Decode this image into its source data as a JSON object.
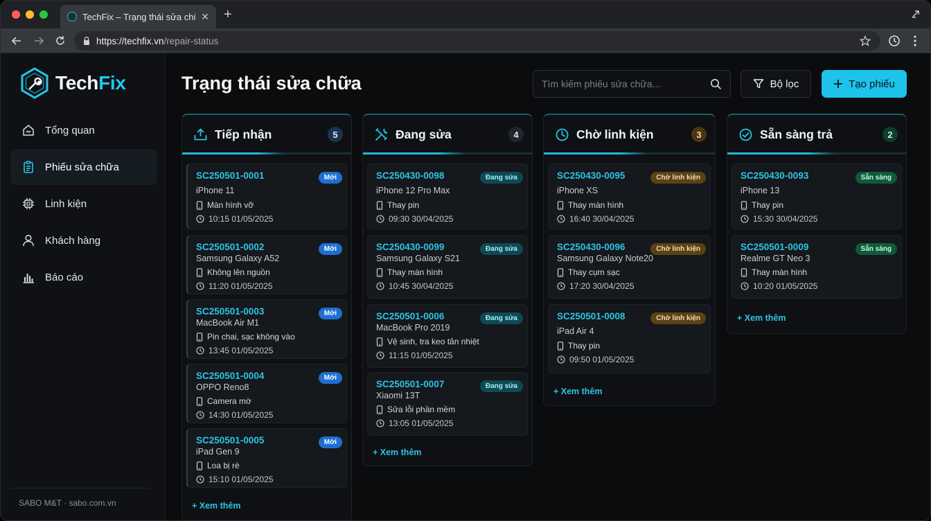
{
  "browser": {
    "tab_title": "TechFix – Trạng thái sửa chữa",
    "url_host": "https://techfix.vn",
    "url_path": "/repair-status"
  },
  "sidebar": {
    "logo_tech": "Tech",
    "logo_fix": "Fix",
    "items": [
      {
        "label": "Tổng quan",
        "icon": "home-icon",
        "active": false
      },
      {
        "label": "Phiếu sửa chữa",
        "icon": "clipboard-icon",
        "active": true
      },
      {
        "label": "Linh kiện",
        "icon": "chip-icon",
        "active": false
      },
      {
        "label": "Khách hàng",
        "icon": "user-icon",
        "active": false
      },
      {
        "label": "Báo cáo",
        "icon": "bar-chart-icon",
        "active": false
      }
    ],
    "footer": "SABO M&T · sabo.com.vn"
  },
  "header": {
    "title": "Trạng thái sửa chữa",
    "search_placeholder": "Tìm kiếm phiếu sửa chữa...",
    "filter_label": "Bộ lọc",
    "create_label": "Tạo phiếu"
  },
  "colors": {
    "accent": "#1ec3ec",
    "badge_new": "#1f6fd1",
    "badge_repair": "#0f4a52",
    "badge_parts": "#5a4214",
    "badge_ready": "#0f5a3a"
  },
  "columns": [
    {
      "title": "Tiếp nhận",
      "count": "5",
      "icon": "inbox-icon",
      "more": "+ Xem thêm",
      "cards": [
        {
          "code": "SC250501-0001",
          "badge": "Mới",
          "device": "iPhone 11",
          "issue": "Màn hình vỡ",
          "time": "10:15 01/05/2025"
        },
        {
          "code": "SC250501-0002",
          "badge": "Mới",
          "device": "Samsung Galaxy A52",
          "issue": "Không lên nguồn",
          "time": "11:20 01/05/2025"
        },
        {
          "code": "SC250501-0003",
          "badge": "Mới",
          "device": "MacBook Air M1",
          "issue": "Pin chai, sạc không vào",
          "time": "13:45 01/05/2025"
        },
        {
          "code": "SC250501-0004",
          "badge": "Mới",
          "device": "OPPO Reno8",
          "issue": "Camera mờ",
          "time": "14:30 01/05/2025"
        },
        {
          "code": "SC250501-0005",
          "badge": "Mới",
          "device": "iPad Gen 9",
          "issue": "Loa bị rè",
          "time": "15:10 01/05/2025"
        }
      ]
    },
    {
      "title": "Đang sửa",
      "count": "4",
      "icon": "tools-icon",
      "more": "+ Xem thêm",
      "cards": [
        {
          "code": "SC250430-0098",
          "badge": "Đang sửa",
          "device": "iPhone 12 Pro Max",
          "issue": "Thay pin",
          "time": "09:30 30/04/2025"
        },
        {
          "code": "SC250430-0099",
          "badge": "Đang sửa",
          "device": "Samsung Galaxy S21",
          "issue": "Thay màn hình",
          "time": "10:45 30/04/2025"
        },
        {
          "code": "SC250501-0006",
          "badge": "Đang sửa",
          "device": "MacBook Pro 2019",
          "issue": "Vệ sinh, tra keo tản nhiệt",
          "time": "11:15 01/05/2025"
        },
        {
          "code": "SC250501-0007",
          "badge": "Đang sửa",
          "device": "Xiaomi 13T",
          "issue": "Sửa lỗi phần mềm",
          "time": "13:05 01/05/2025"
        }
      ]
    },
    {
      "title": "Chờ linh kiện",
      "count": "3",
      "icon": "clock-icon",
      "more": "+ Xem thêm",
      "cards": [
        {
          "code": "SC250430-0095",
          "badge": "Chờ linh kiện",
          "device": "iPhone XS",
          "issue": "Thay màn hình",
          "time": "16:40 30/04/2025"
        },
        {
          "code": "SC250430-0096",
          "badge": "Chờ linh kiện",
          "device": "Samsung Galaxy Note20",
          "issue": "Thay cụm sạc",
          "time": "17:20 30/04/2025"
        },
        {
          "code": "SC250501-0008",
          "badge": "Chờ linh kiện",
          "device": "iPad Air 4",
          "issue": "Thay pin",
          "time": "09:50 01/05/2025"
        }
      ]
    },
    {
      "title": "Sẵn sàng trả",
      "count": "2",
      "icon": "check-circle-icon",
      "more": "+ Xem thêm",
      "cards": [
        {
          "code": "SC250430-0093",
          "badge": "Sẵn sàng",
          "device": "iPhone 13",
          "issue": "Thay pin",
          "time": "15:30 30/04/2025"
        },
        {
          "code": "SC250501-0009",
          "badge": "Sẵn sàng",
          "device": "Realme GT Neo 3",
          "issue": "Thay màn hình",
          "time": "10:20 01/05/2025"
        }
      ]
    }
  ]
}
